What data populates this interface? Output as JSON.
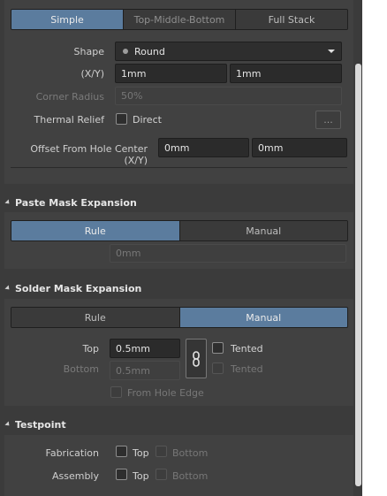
{
  "top_tabs": [
    "Simple",
    "Top-Middle-Bottom",
    "Full Stack"
  ],
  "shape": {
    "label": "Shape",
    "value": "Round"
  },
  "xy": {
    "label": "(X/Y)",
    "x": "1mm",
    "y": "1mm"
  },
  "corner_radius": {
    "label": "Corner Radius",
    "value": "50%"
  },
  "thermal_relief": {
    "label": "Thermal Relief",
    "checkbox_label": "Direct",
    "button_label": "..."
  },
  "offset": {
    "label": "Offset From Hole Center (X/Y)",
    "x": "0mm",
    "y": "0mm"
  },
  "paste_mask": {
    "title": "Paste Mask Expansion",
    "tabs": [
      "Rule",
      "Manual"
    ],
    "value": "0mm"
  },
  "solder_mask": {
    "title": "Solder Mask Expansion",
    "tabs": [
      "Rule",
      "Manual"
    ],
    "top_label": "Top",
    "top_value": "0.5mm",
    "bottom_label": "Bottom",
    "bottom_value": "0.5mm",
    "tented_label": "Tented",
    "from_hole_edge": "From Hole Edge"
  },
  "testpoint": {
    "title": "Testpoint",
    "fabrication_label": "Fabrication",
    "assembly_label": "Assembly",
    "top_label": "Top",
    "bottom_label": "Bottom"
  },
  "colors": {
    "accent": "#5b7c9e",
    "panel": "#414141",
    "background": "#3b3b3b"
  }
}
